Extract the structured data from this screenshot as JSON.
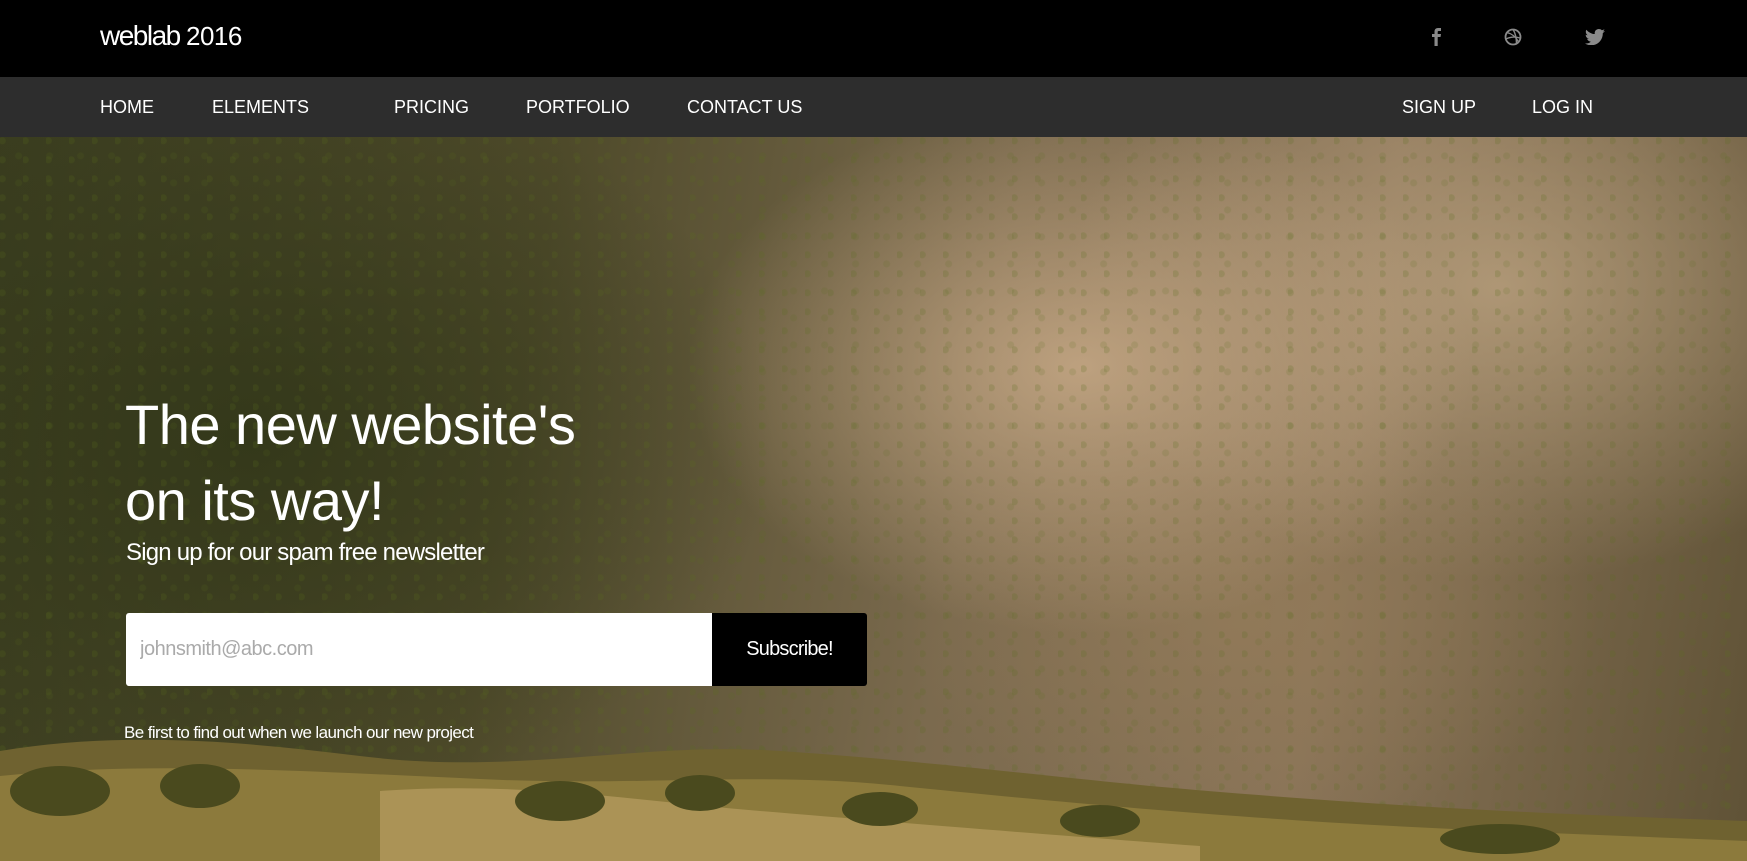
{
  "brand": {
    "name": "weblab",
    "year": "2016"
  },
  "social": [
    {
      "icon": "facebook-icon"
    },
    {
      "icon": "dribbble-icon"
    },
    {
      "icon": "twitter-icon"
    }
  ],
  "nav": {
    "left": [
      "HOME",
      "ELEMENTS",
      "PRICING",
      "PORTFOLIO",
      "CONTACT US"
    ],
    "right": [
      "SIGN UP",
      "LOG IN"
    ]
  },
  "hero": {
    "headline_line1": "The new website's",
    "headline_line2": "on its way!",
    "subline": "Sign up for our spam free newsletter",
    "email_placeholder": "johnsmith@abc.com",
    "subscribe_label": "Subscribe!",
    "note": "Be first to find out when we launch our new project"
  },
  "colors": {
    "topbar": "#000000",
    "navbar": "#2d2d2d",
    "button": "#000000",
    "icon": "#8a8a8a"
  }
}
